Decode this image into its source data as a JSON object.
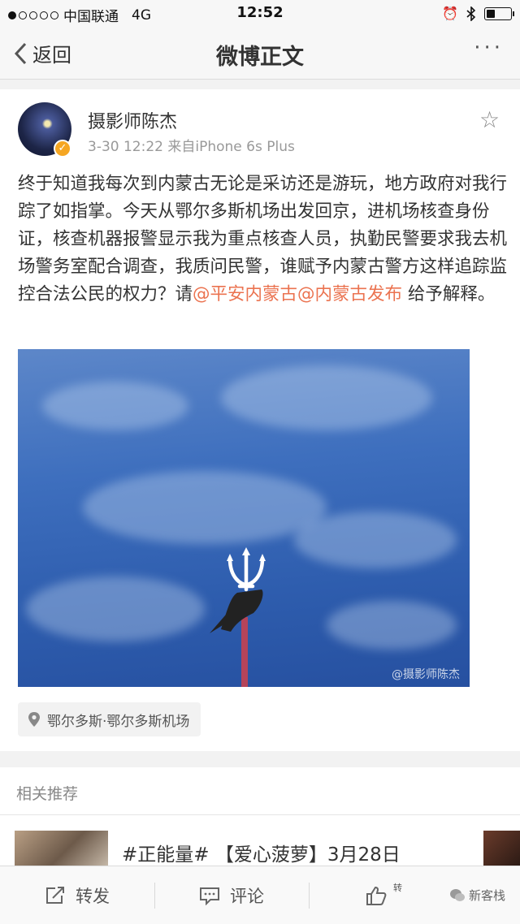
{
  "status_bar": {
    "carrier": "中国联通",
    "network": "4G",
    "time": "12:52"
  },
  "nav": {
    "back_label": "返回",
    "title": "微博正文",
    "more_label": "···"
  },
  "post": {
    "author": "摄影师陈杰",
    "meta": "3-30 12:22  来自iPhone 6s Plus",
    "text_before": "终于知道我每次到内蒙古无论是采访还是游玩，地方政府对我行踪了如指掌。今天从鄂尔多斯机场出发回京，进机场核查身份证，核查机器报警显示我为重点核查人员，执勤民警要求我去机场警务室配合调查，我质问民警，谁赋予内蒙古警方这样追踪监控合法公民的权力？请",
    "mention1": "@平安内蒙古",
    "mention2": "@内蒙古发布",
    "text_after": " 给予解释。",
    "photo_watermark": "@摄影师陈杰",
    "location": "鄂尔多斯·鄂尔多斯机场"
  },
  "related": {
    "heading": "相关推荐",
    "item_title": "#正能量# 【爱心菠萝】3月28日"
  },
  "toolbar": {
    "repost": "转发",
    "comment": "评论",
    "like_count": "转"
  },
  "brand": "新客栈",
  "colors": {
    "mention": "#eb7350",
    "badge": "#f5a623"
  }
}
